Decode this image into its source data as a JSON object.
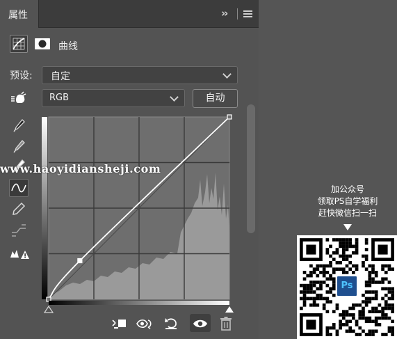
{
  "panel": {
    "tab_label": "属性",
    "collapse_glyph": "››",
    "title": "曲线",
    "preset_label": "预设:",
    "preset_value": "自定",
    "channel_value": "RGB",
    "auto_label": "自动"
  },
  "curve": {
    "points": [
      [
        0,
        0
      ],
      [
        44,
        54
      ],
      [
        255,
        255
      ]
    ]
  },
  "watermark": "www.haoyidiansheji.com",
  "promo": {
    "line1": "加公众号",
    "line2": "领取PS自学福利",
    "line3": "赶快微信扫一扫",
    "logo_text": "Ps"
  },
  "icons": {
    "tools": [
      "eyedropper-black-icon",
      "eyedropper-gray-icon",
      "eyedropper-white-icon",
      "curve-edit-icon",
      "pencil-icon",
      "smooth-icon",
      "clipping-warning-icon"
    ],
    "bottom": [
      "clip-to-layer-icon",
      "view-previous-icon",
      "reset-icon",
      "visibility-eye-icon",
      "trash-icon"
    ]
  },
  "colors": {
    "panel_bg": "#535353",
    "tabbar_bg": "#3c3c3c",
    "graph_bg": "#6e6e6e",
    "histogram": "#9a9a9a"
  }
}
